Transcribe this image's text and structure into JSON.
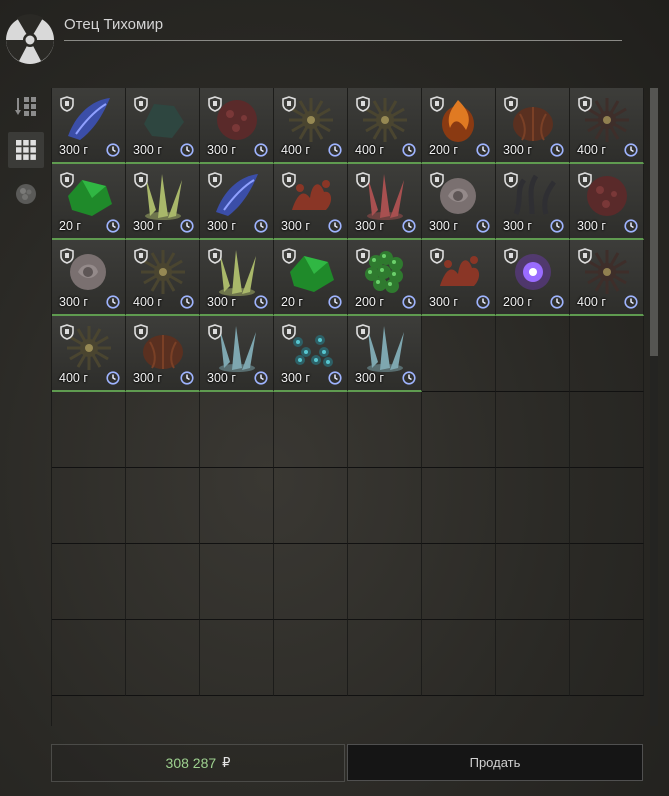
{
  "header": {
    "trader_name": "Отец Тихомир"
  },
  "side_tabs": [
    {
      "icon": "sort-icon",
      "active": false
    },
    {
      "icon": "grid-icon",
      "active": true
    },
    {
      "icon": "artifact-category-icon",
      "active": false
    }
  ],
  "inventory": {
    "items": [
      {
        "weight": "300 г",
        "icon": "blue-feather-artifact-icon",
        "color": "#3b4ea8"
      },
      {
        "weight": "300 г",
        "icon": "dark-teal-crystal-artifact-icon",
        "color": "#2e4640"
      },
      {
        "weight": "300 г",
        "icon": "red-spore-ball-artifact-icon",
        "color": "#5a2a2a"
      },
      {
        "weight": "400 г",
        "icon": "spiky-sea-urchin-artifact-icon",
        "color": "#4a4530"
      },
      {
        "weight": "400 г",
        "icon": "spiky-sea-urchin-artifact-icon",
        "color": "#4a4530"
      },
      {
        "weight": "200 г",
        "icon": "fire-ball-artifact-icon",
        "color": "#8a3a12"
      },
      {
        "weight": "300 г",
        "icon": "dark-orange-bulb-artifact-icon",
        "color": "#5a3020"
      },
      {
        "weight": "400 г",
        "icon": "dark-spiky-artifact-icon",
        "color": "#3e2e2a"
      },
      {
        "weight": "20 г",
        "icon": "green-crystal-artifact-icon",
        "color": "#1f8a2a"
      },
      {
        "weight": "300 г",
        "icon": "yellow-green-shard-artifact-icon",
        "color": "#a9b86a"
      },
      {
        "weight": "300 г",
        "icon": "blue-feather-artifact-icon",
        "color": "#3b4ea8"
      },
      {
        "weight": "300 г",
        "icon": "red-coral-artifact-icon",
        "color": "#8a3626"
      },
      {
        "weight": "300 г",
        "icon": "pink-shard-artifact-icon",
        "color": "#a85050"
      },
      {
        "weight": "300 г",
        "icon": "grey-rose-artifact-icon",
        "color": "#7a7070"
      },
      {
        "weight": "300 г",
        "icon": "dark-tendril-artifact-icon",
        "color": "#2f2f33"
      },
      {
        "weight": "300 г",
        "icon": "red-spore-ball-artifact-icon",
        "color": "#5a2a2a"
      },
      {
        "weight": "300 г",
        "icon": "grey-rose-artifact-icon",
        "color": "#7a7070"
      },
      {
        "weight": "400 г",
        "icon": "spiky-sea-urchin-artifact-icon",
        "color": "#4a4530"
      },
      {
        "weight": "300 г",
        "icon": "yellow-green-shard-artifact-icon",
        "color": "#a9b86a"
      },
      {
        "weight": "20 г",
        "icon": "green-crystal-artifact-icon",
        "color": "#1f8a2a"
      },
      {
        "weight": "200 г",
        "icon": "green-berry-cluster-artifact-icon",
        "color": "#2f7a2f"
      },
      {
        "weight": "300 г",
        "icon": "red-coral-artifact-icon",
        "color": "#8a3626"
      },
      {
        "weight": "200 г",
        "icon": "purple-glow-artifact-icon",
        "color": "#6a3aa8"
      },
      {
        "weight": "400 г",
        "icon": "dark-spiky-artifact-icon",
        "color": "#3e2e2a"
      },
      {
        "weight": "400 г",
        "icon": "spiky-sea-urchin-artifact-icon",
        "color": "#4a4530"
      },
      {
        "weight": "300 г",
        "icon": "dark-orange-bulb-artifact-icon",
        "color": "#5a3020"
      },
      {
        "weight": "300 г",
        "icon": "ice-crystal-artifact-icon",
        "color": "#7ea7b0"
      },
      {
        "weight": "300 г",
        "icon": "teal-dots-artifact-icon",
        "color": "#2d6066"
      },
      {
        "weight": "300 г",
        "icon": "ice-crystal-artifact-icon",
        "color": "#7ea7b0"
      }
    ],
    "total_slots": 64
  },
  "footer": {
    "total": "308 287",
    "currency": "₽",
    "sell_label": "Продать"
  },
  "colors": {
    "accent_green": "#5f9b50",
    "total_green": "#9ed18f"
  }
}
